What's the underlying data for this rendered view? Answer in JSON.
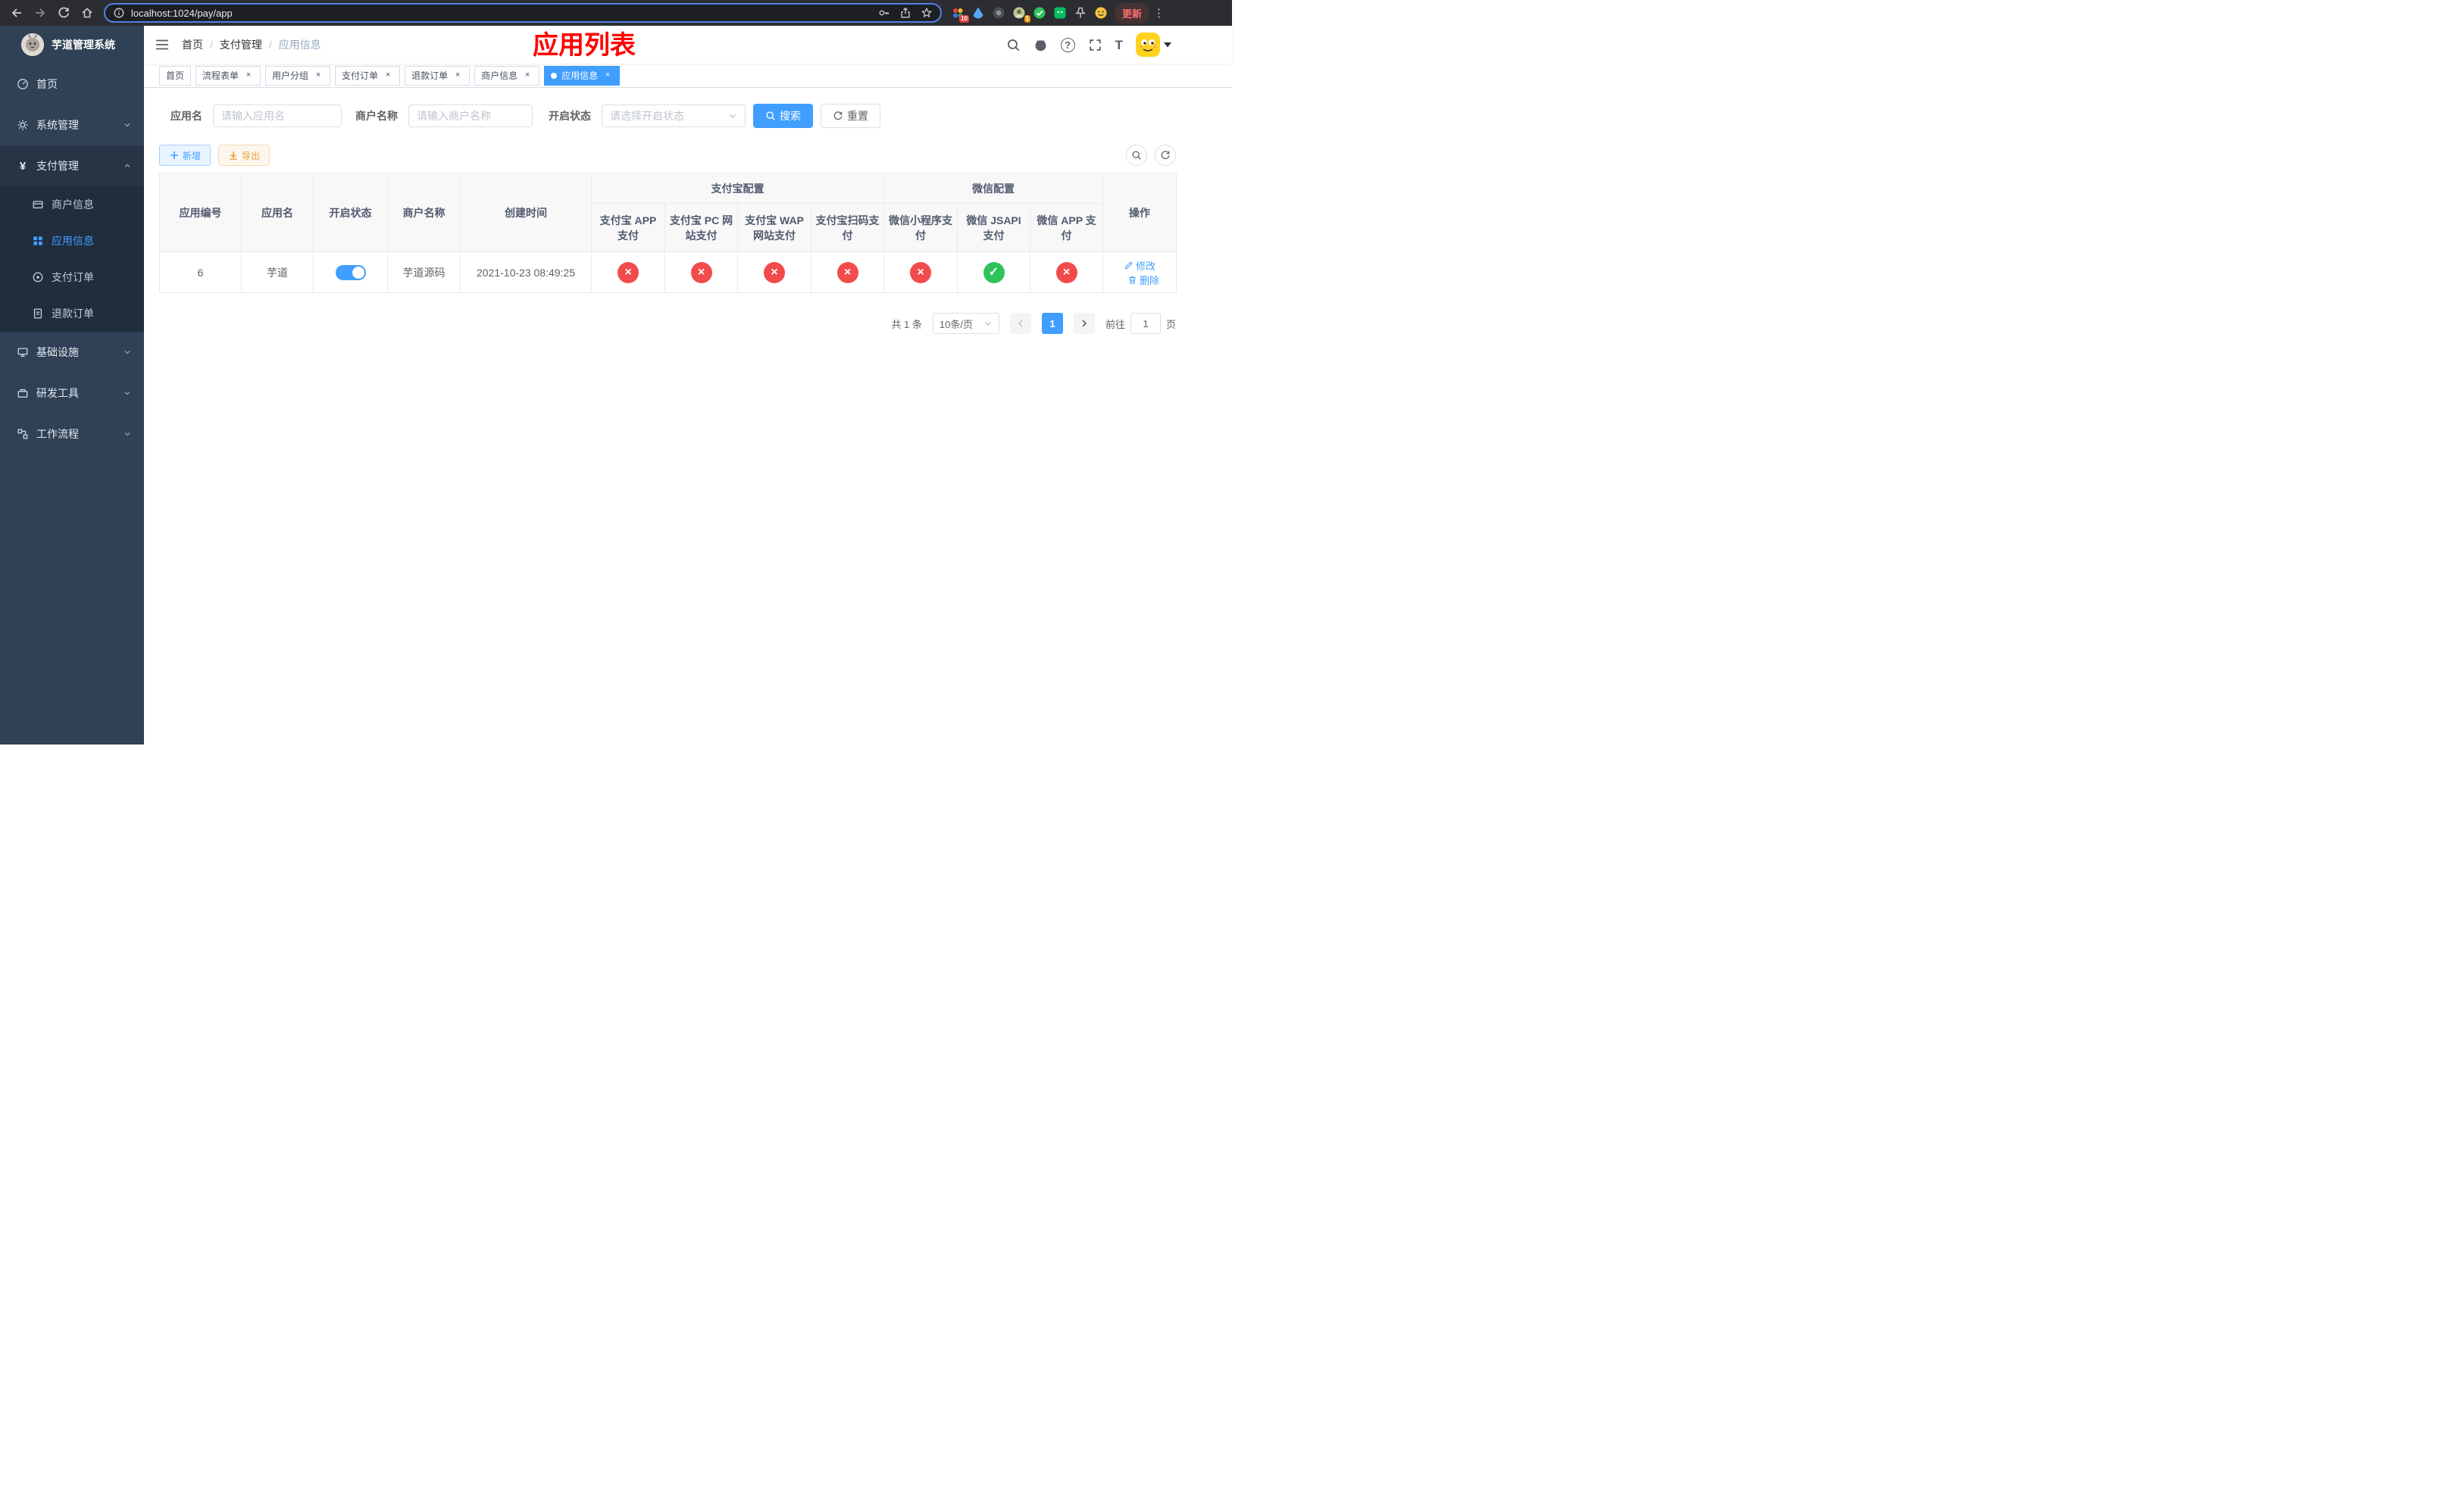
{
  "browser": {
    "url": "localhost:1024/pay/app",
    "update_label": "更新",
    "extension_badges": {
      "first": "10",
      "second": "1"
    }
  },
  "icons": {
    "pay_symbol": "¥",
    "cross_glyph": "×",
    "check_glyph": "✓",
    "more_glyph": "⋮",
    "question_glyph": "?",
    "text_size_glyph": "T"
  },
  "sidebar": {
    "app_title": "芋道管理系统",
    "items": [
      {
        "label": "首页"
      },
      {
        "label": "系统管理"
      },
      {
        "label": "支付管理"
      },
      {
        "label": "基础设施"
      },
      {
        "label": "研发工具"
      },
      {
        "label": "工作流程"
      }
    ],
    "payment_submenu": [
      {
        "label": "商户信息"
      },
      {
        "label": "应用信息",
        "active": true
      },
      {
        "label": "支付订单"
      },
      {
        "label": "退款订单"
      }
    ]
  },
  "header": {
    "breadcrumb": [
      "首页",
      "支付管理",
      "应用信息"
    ],
    "page_title": "应用列表"
  },
  "tabs": [
    {
      "label": "首页",
      "closable": false
    },
    {
      "label": "流程表单",
      "closable": true
    },
    {
      "label": "用户分组",
      "closable": true
    },
    {
      "label": "支付订单",
      "closable": true
    },
    {
      "label": "退款订单",
      "closable": true
    },
    {
      "label": "商户信息",
      "closable": true
    },
    {
      "label": "应用信息",
      "closable": true,
      "active": true
    }
  ],
  "filters": {
    "app_name_label": "应用名",
    "app_name_placeholder": "请输入应用名",
    "merchant_label": "商户名称",
    "merchant_placeholder": "请输入商户名称",
    "status_label": "开启状态",
    "status_placeholder": "请选择开启状态",
    "search_label": "搜索",
    "reset_label": "重置"
  },
  "toolbar": {
    "add_label": "新增",
    "export_label": "导出"
  },
  "table": {
    "groups": {
      "alipay": "支付宝配置",
      "wechat": "微信配置"
    },
    "columns": {
      "app_id": "应用编号",
      "app_name": "应用名",
      "status": "开启状态",
      "merchant": "商户名称",
      "created": "创建时间",
      "alipay_app": "支付宝 APP 支付",
      "alipay_pc": "支付宝 PC 网站支付",
      "alipay_wap": "支付宝 WAP 网站支付",
      "alipay_qr": "支付宝扫码支付",
      "wx_mini": "微信小程序支付",
      "wx_jsapi": "微信 JSAPI 支付",
      "wx_app": "微信 APP 支付",
      "ops": "操作"
    },
    "rows": [
      {
        "app_id": "6",
        "app_name": "芋道",
        "enabled": true,
        "merchant": "芋道源码",
        "created": "2021-10-23 08:49:25",
        "channels": [
          "no",
          "no",
          "no",
          "no",
          "no",
          "yes",
          "no"
        ],
        "edit_label": "修改",
        "delete_label": "删除"
      }
    ]
  },
  "pagination": {
    "total": "共 1 条",
    "page_size": "10条/页",
    "current_page": "1",
    "goto_label": "前往",
    "goto_value": "1",
    "page_unit": "页"
  },
  "colors": {
    "accent": "#409eff",
    "sidebar_bg": "#304156",
    "submenu_bg": "#1f2d3d",
    "title_red": "#ff0000",
    "danger_circle": "#f24b4b",
    "success_circle": "#2fc25b",
    "warning": "#e6a23c"
  }
}
